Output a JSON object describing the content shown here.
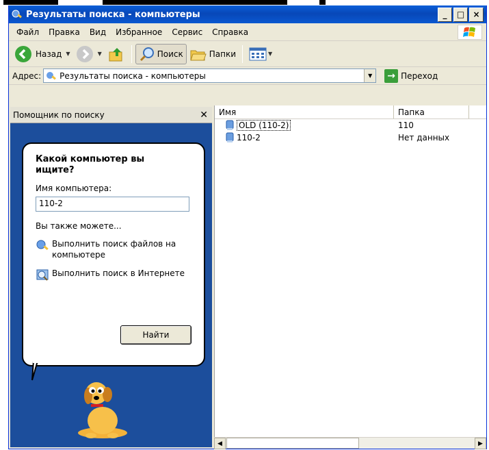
{
  "window": {
    "title": "Результаты поиска - компьютеры"
  },
  "menu": [
    {
      "label": "Файл"
    },
    {
      "label": "Правка"
    },
    {
      "label": "Вид"
    },
    {
      "label": "Избранное"
    },
    {
      "label": "Сервис"
    },
    {
      "label": "Справка"
    }
  ],
  "toolbar": {
    "back": "Назад",
    "search": "Поиск",
    "folders": "Папки"
  },
  "address": {
    "label": "Адрес:",
    "value": "Результаты поиска - компьютеры",
    "go": "Переход"
  },
  "assistant": {
    "header": "Помощник по поиску",
    "question": "Какой компьютер вы ищите?",
    "field_label": "Имя компьютера:",
    "field_value": "110-2",
    "also": "Вы также можете...",
    "link1": "Выполнить поиск файлов на компьютере",
    "link2": "Выполнить поиск в Интернете",
    "find_button": "Найти"
  },
  "results": {
    "columns": [
      "Имя",
      "Папка"
    ],
    "rows": [
      {
        "name": "OLD (110-2)",
        "folder": "110"
      },
      {
        "name": "110-2",
        "folder": "Нет данных"
      }
    ]
  }
}
